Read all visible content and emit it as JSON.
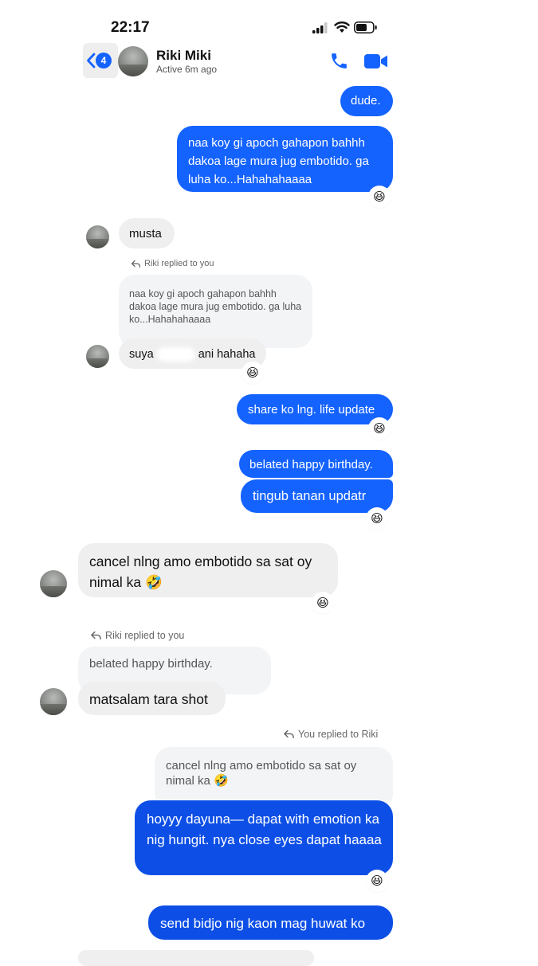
{
  "status": {
    "time": "22:17"
  },
  "header": {
    "back_count": "4",
    "contact_name": "Riki Miki",
    "active_status": "Active 6m ago"
  },
  "messages": {
    "m1": "dude.",
    "m2": "naa koy gi apoch gahapon bahhh dakoa lage mura jug embotido. ga luha  ko...Hahahahaaaa",
    "m3": "musta",
    "m4_replied": "Riki replied to you",
    "m4_quote": "naa koy gi apoch gahapon bahhh dakoa lage mura jug embotido. ga luha  ko...Hahahahaaaa",
    "m4_a": "suya ",
    "m4_b": " ani hahaha",
    "m5": "share ko lng. life update",
    "m6": "belated happy birthday.",
    "m7": "tingub tanan updatr",
    "m8": "cancel nlng amo embotido sa sat oy nimal ka 🤣",
    "m9_replied": "Riki replied to you",
    "m9_quote": "belated happy birthday.",
    "m9": "matsalam tara shot",
    "m10_replied": "You replied to Riki",
    "m10_quote": "cancel nlng amo embotido sa sat oy nimal ka 🤣",
    "m10": "hoyyy dayuna— dapat with emotion ka nig hungit. nya close eyes dapat haaaa",
    "m11": "send bidjo nig kaon mag huwat ko"
  },
  "reactions": {
    "laugh": "😆"
  },
  "colors": {
    "accent": "#1563ff",
    "accent_dark": "#0d4fe6",
    "incoming": "#efefef"
  }
}
